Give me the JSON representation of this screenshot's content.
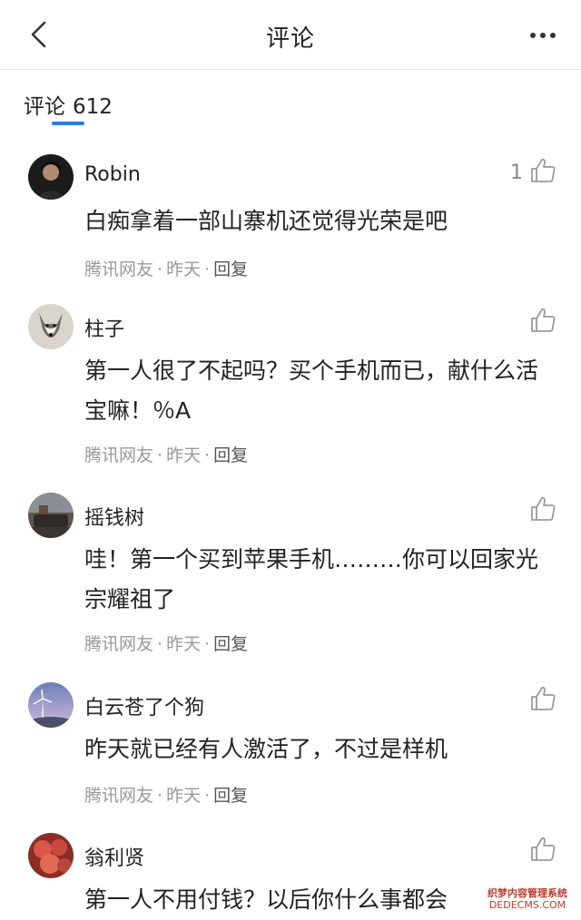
{
  "header": {
    "title": "评论"
  },
  "comments_header": {
    "label": "评论",
    "count": "612"
  },
  "comments": [
    {
      "username": "Robin",
      "likes": "1",
      "text": "白痴拿着一部山寨机还觉得光荣是吧",
      "source": "腾讯网友",
      "time": "昨天",
      "reply": "回复"
    },
    {
      "username": "柱子",
      "likes": "",
      "text": "第一人很了不起吗？买个手机而已，献什么活宝嘛！％A",
      "source": "腾讯网友",
      "time": "昨天",
      "reply": "回复"
    },
    {
      "username": "摇钱树",
      "likes": "",
      "text": "哇！第一个买到苹果手机………你可以回家光宗耀祖了",
      "source": "腾讯网友",
      "time": "昨天",
      "reply": "回复"
    },
    {
      "username": "白云苍了个狗",
      "likes": "",
      "text": "昨天就已经有人激活了，不过是样机",
      "source": "腾讯网友",
      "time": "昨天",
      "reply": "回复"
    },
    {
      "username": "翁利贤",
      "likes": "",
      "text": "第一人不用付钱？以后你什么事都会",
      "source": "",
      "time": "",
      "reply": ""
    }
  ],
  "watermark": {
    "line1": "织梦内容管理系统",
    "line2": "DEDECMS.COM"
  },
  "colors": {
    "accent": "#2a7de1",
    "meta": "#999999",
    "like_icon": "#9a9a9a"
  }
}
